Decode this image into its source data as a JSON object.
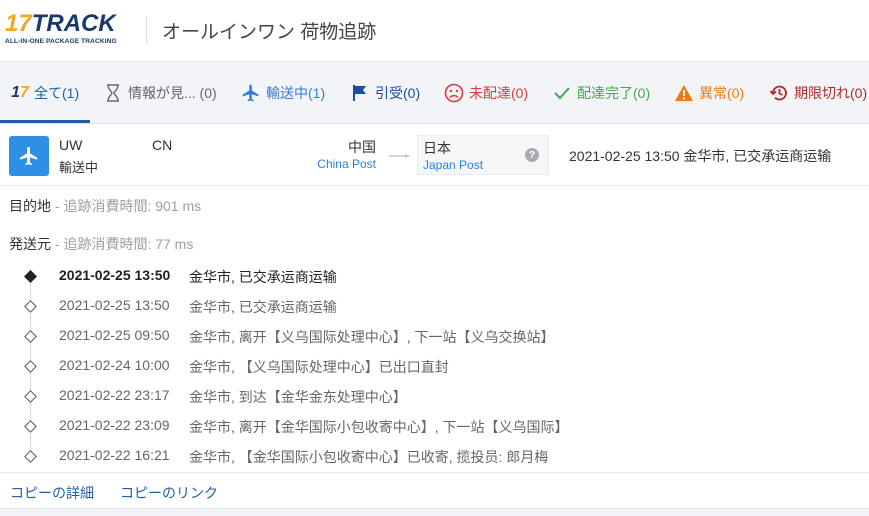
{
  "header": {
    "logo_number": "17",
    "logo_word": "TRACK",
    "logo_tagline": "ALL-IN-ONE PACKAGE TRACKING",
    "title": "オールインワン 荷物追跡"
  },
  "tabs": [
    {
      "label": "全て(1)",
      "icon": "17-logo-icon",
      "active": true
    },
    {
      "label": "情報が見... (0)",
      "icon": "hourglass-icon"
    },
    {
      "label": "輸送中(1)",
      "icon": "airplane-icon",
      "color": "#2f7de1"
    },
    {
      "label": "引受(0)",
      "icon": "flag-icon",
      "color": "#1b4ea0"
    },
    {
      "label": "未配達(0)",
      "icon": "sad-face-icon",
      "color": "#e03a3a"
    },
    {
      "label": "配達完了(0)",
      "icon": "check-icon",
      "color": "#46a84a"
    },
    {
      "label": "異常(0)",
      "icon": "warning-icon",
      "color": "#f07a10"
    },
    {
      "label": "期限切れ(0)",
      "icon": "history-icon",
      "color": "#b42a2a"
    }
  ],
  "package": {
    "origin_code": "UW",
    "dest_code": "CN",
    "status": "輸送中",
    "origin_country": "中国",
    "origin_carrier": "China Post",
    "dest_country": "日本",
    "dest_carrier": "Japan Post",
    "latest_event": "2021-02-25 13:50  金华市, 已交承运商运输"
  },
  "sections": {
    "destination": {
      "label": "目的地",
      "sub": " - 追跡消費時間: 901 ms"
    },
    "origin": {
      "label": "発送元",
      "sub": " - 追跡消費時間: 77 ms"
    }
  },
  "events": [
    {
      "time": "2021-02-25 13:50",
      "desc": "金华市, 已交承运商运输"
    },
    {
      "time": "2021-02-25 13:50",
      "desc": "金华市, 已交承运商运输"
    },
    {
      "time": "2021-02-25 09:50",
      "desc": "金华市, 离开【义乌国际处理中心】, 下一站【义乌交换站】"
    },
    {
      "time": "2021-02-24 10:00",
      "desc": "金华市, 【义乌国际处理中心】已出口直封"
    },
    {
      "time": "2021-02-22 23:17",
      "desc": "金华市, 到达【金华金东处理中心】"
    },
    {
      "time": "2021-02-22 23:09",
      "desc": "金华市, 离开【金华国际小包收寄中心】, 下一站【义乌国际】"
    },
    {
      "time": "2021-02-22 16:21",
      "desc": "金华市, 【金华国际小包收寄中心】已收寄, 揽投员: 郎月梅"
    }
  ],
  "footer": {
    "copy_details": "コピーの詳細",
    "copy_link": "コピーのリンク"
  },
  "colors": {
    "accent": "#1f5fa8",
    "status_transit": "#2f8ee6"
  }
}
